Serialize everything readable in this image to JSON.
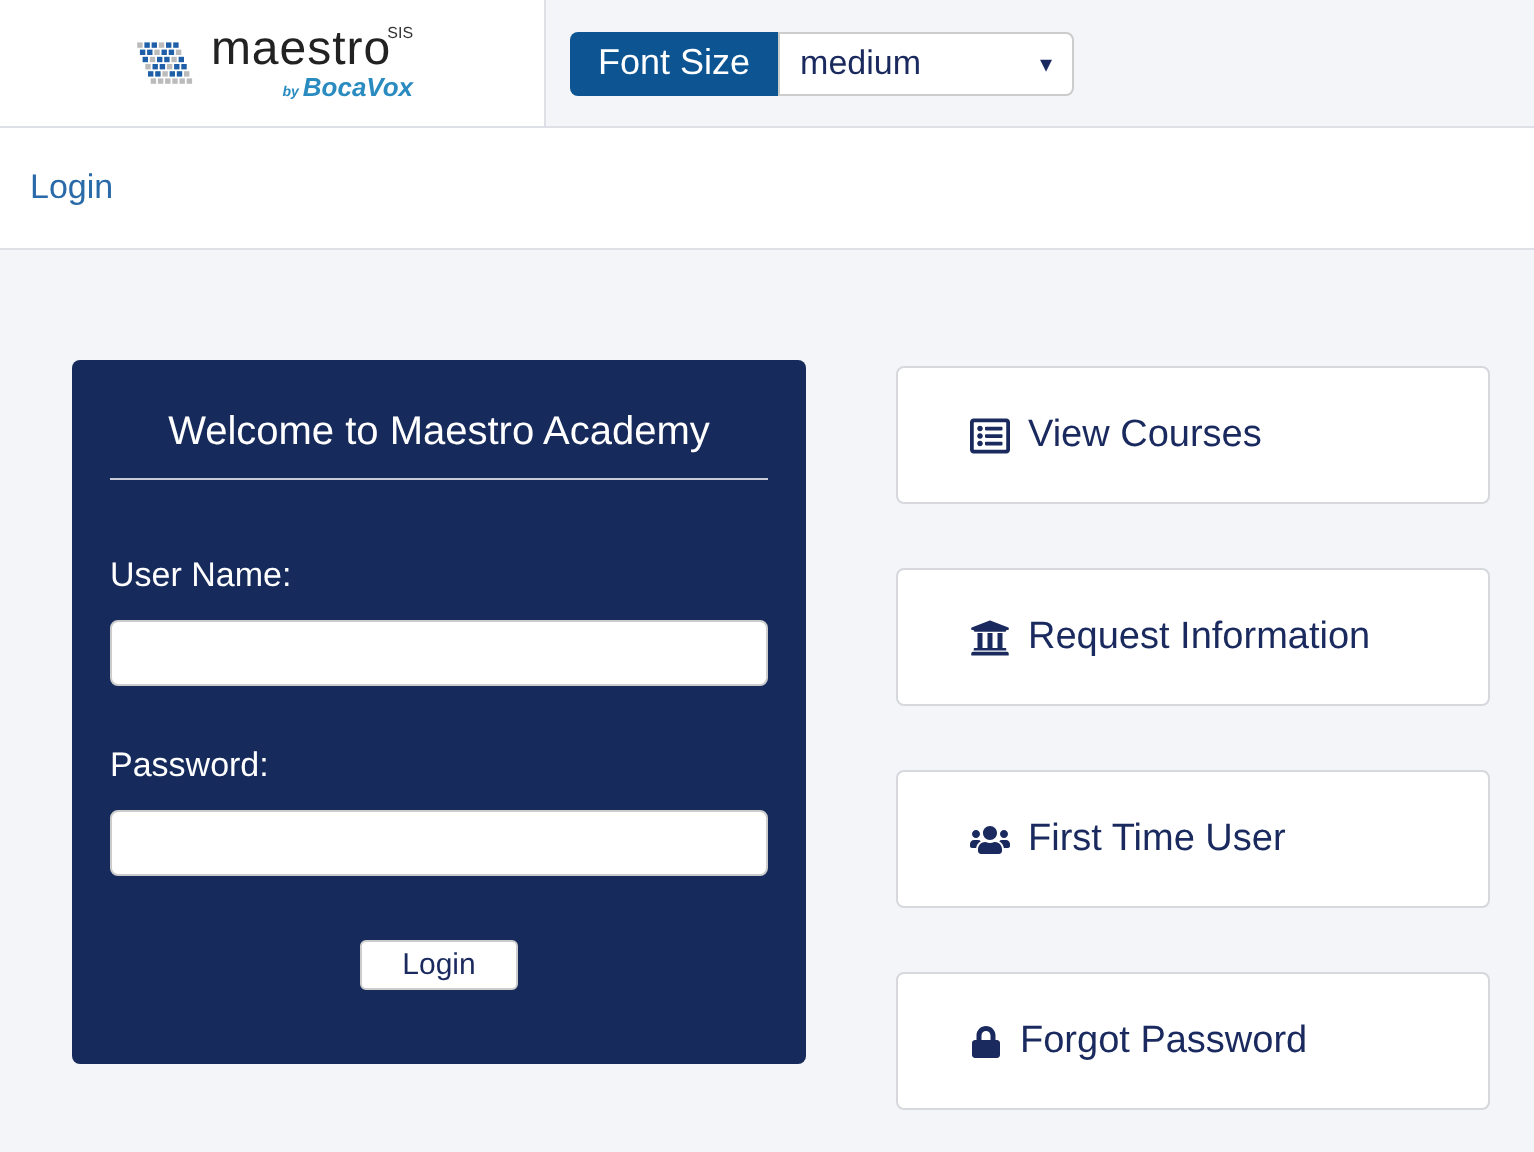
{
  "logo": {
    "name": "maestro",
    "suffix": "SIS",
    "by": "by",
    "brand": "BocaVox"
  },
  "font_size": {
    "label": "Font Size",
    "value": "medium",
    "arrow": "▾"
  },
  "breadcrumb": "Login",
  "login_panel": {
    "title": "Welcome to Maestro Academy",
    "fields": [
      {
        "label": "User Name:"
      },
      {
        "label": "Password:"
      }
    ],
    "button": "Login"
  },
  "actions": [
    {
      "label": "View Courses",
      "kind": "list"
    },
    {
      "label": "Request Information",
      "kind": "bank"
    },
    {
      "label": "First Time User",
      "kind": "users"
    },
    {
      "label": "Forgot Password",
      "kind": "lock"
    }
  ]
}
